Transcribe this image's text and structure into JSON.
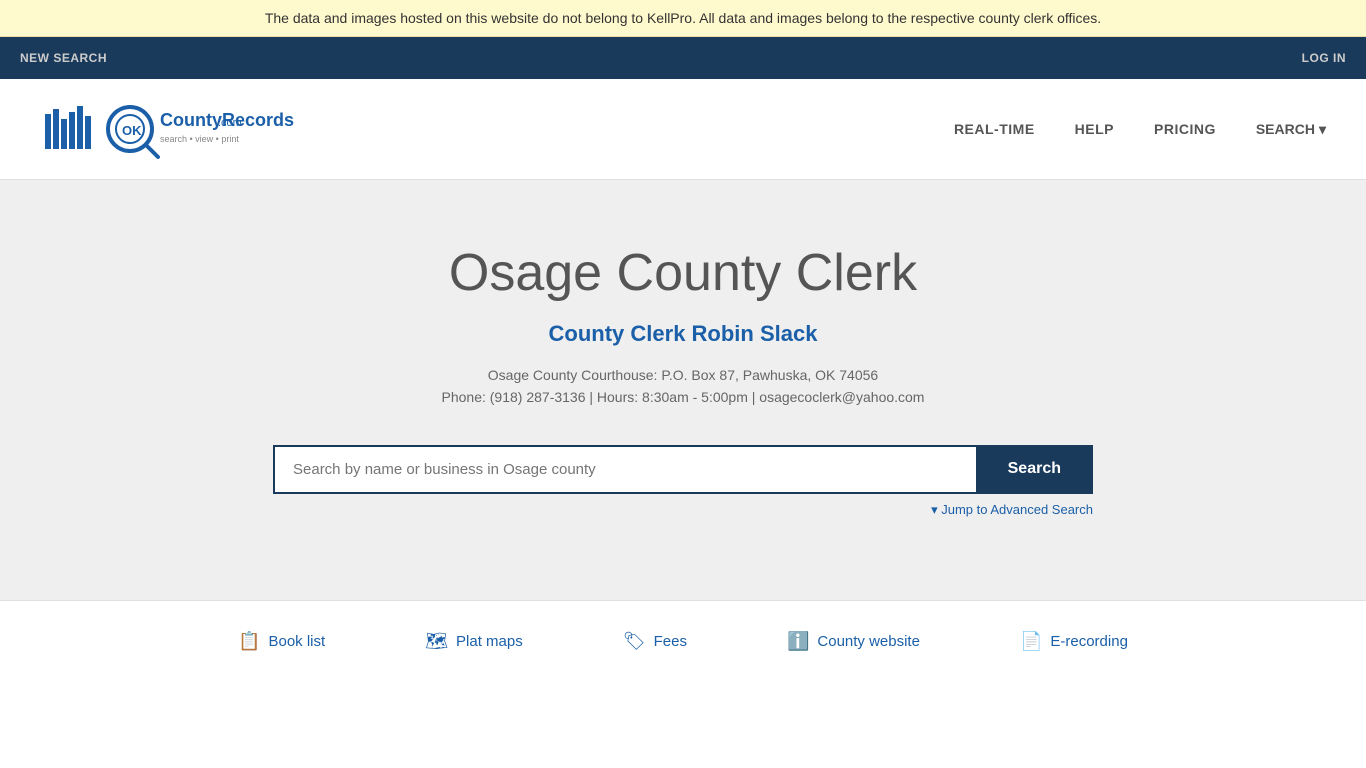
{
  "banner": {
    "text": "The data and images hosted on this website do not belong to KellPro. All data and images belong to the respective county clerk offices."
  },
  "topNav": {
    "newSearch": "NEW SEARCH",
    "login": "LOG IN"
  },
  "header": {
    "logoAlt": "OKCountyRecords.com - search · view · print",
    "navItems": [
      {
        "label": "REAL-TIME",
        "href": "#"
      },
      {
        "label": "HELP",
        "href": "#"
      },
      {
        "label": "PRICING",
        "href": "#"
      },
      {
        "label": "SEARCH",
        "href": "#",
        "hasDropdown": true
      }
    ]
  },
  "hero": {
    "title": "Osage County Clerk",
    "subtitle": "County Clerk Robin Slack",
    "address": "Osage County Courthouse: P.O. Box 87, Pawhuska, OK 74056",
    "contact": "Phone: (918) 287-3136 | Hours: 8:30am - 5:00pm | osagecoclerk@yahoo.com",
    "searchPlaceholder": "Search by name or business in Osage county",
    "searchButton": "Search",
    "advancedLink": "▾ Jump to Advanced Search"
  },
  "footerLinks": [
    {
      "icon": "📋",
      "label": "Book list",
      "href": "#"
    },
    {
      "icon": "🗺",
      "label": "Plat maps",
      "href": "#"
    },
    {
      "icon": "🏷",
      "label": "Fees",
      "href": "#"
    },
    {
      "icon": "ℹ",
      "label": "County website",
      "href": "#"
    },
    {
      "icon": "📄",
      "label": "E-recording",
      "href": "#"
    }
  ]
}
